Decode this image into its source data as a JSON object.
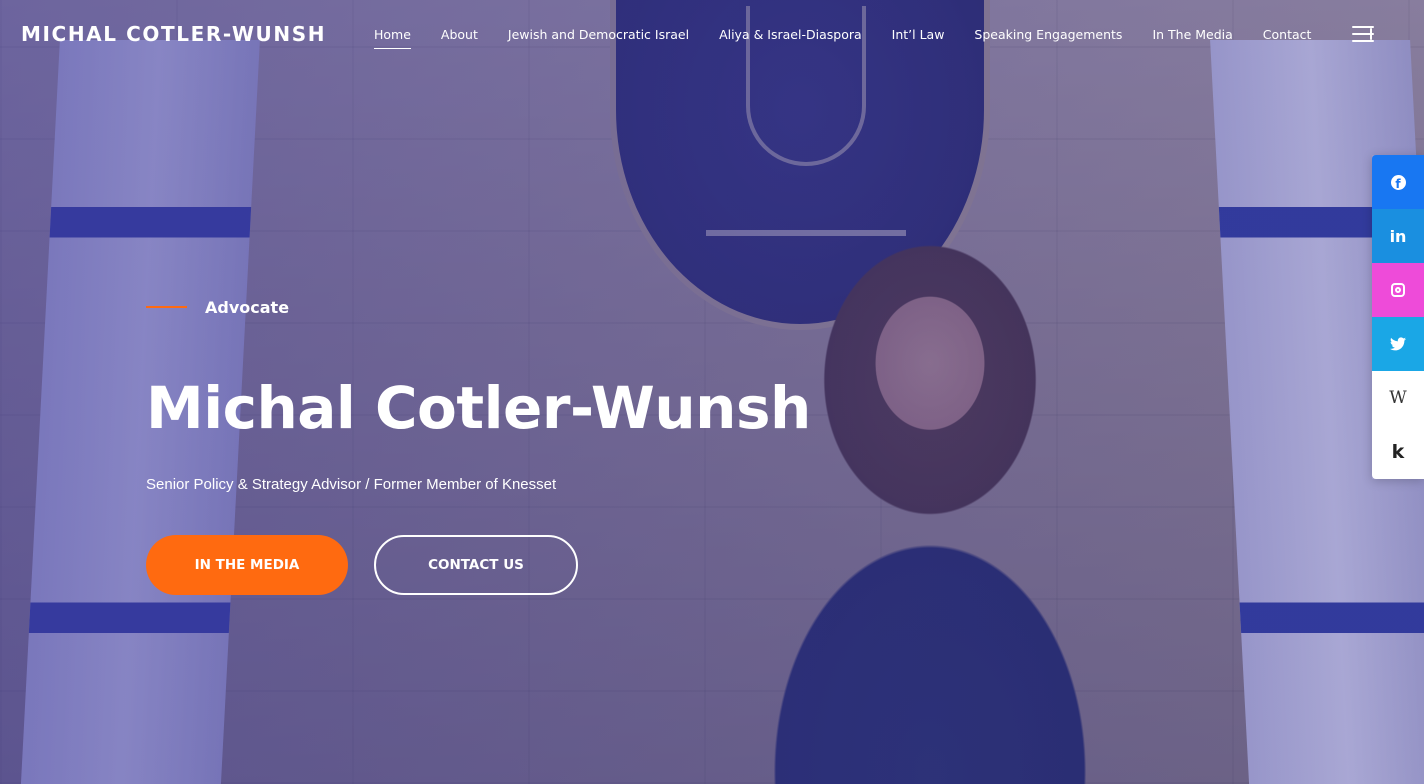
{
  "site": {
    "logo": "MICHAL COTLER-WUNSH"
  },
  "nav": {
    "items": [
      {
        "label": "Home",
        "active": true
      },
      {
        "label": "About"
      },
      {
        "label": "Jewish and Democratic Israel"
      },
      {
        "label": "Aliya & Israel-Diaspora"
      },
      {
        "label": "Int’l Law"
      },
      {
        "label": "Speaking Engagements"
      },
      {
        "label": "In The Media"
      },
      {
        "label": "Contact"
      }
    ],
    "menu_icon": "sidebar-menu-icon"
  },
  "hero": {
    "tagline": "Advocate",
    "title": "Michal Cotler-Wunsh",
    "subtitle": "Senior Policy & Strategy Advisor / Former Member of Knesset",
    "primary_button": "IN THE MEDIA",
    "secondary_button": "CONTACT US"
  },
  "social": [
    {
      "name": "facebook",
      "icon": "facebook-icon",
      "color": "#1877f2"
    },
    {
      "name": "linkedin",
      "icon": "linkedin-icon",
      "glyph": "in",
      "color": "#1a8fe0"
    },
    {
      "name": "instagram",
      "icon": "instagram-icon",
      "color": "#ee4bd9"
    },
    {
      "name": "twitter",
      "icon": "twitter-icon",
      "color": "#1aa7e6"
    },
    {
      "name": "wikipedia",
      "icon": "wikipedia-icon",
      "glyph": "W",
      "color": "#ffffff"
    },
    {
      "name": "klout",
      "icon": "k-icon",
      "glyph": "k",
      "color": "#ffffff"
    }
  ],
  "colors": {
    "accent": "#ff6a10",
    "overlay": "#3e3aa0"
  }
}
